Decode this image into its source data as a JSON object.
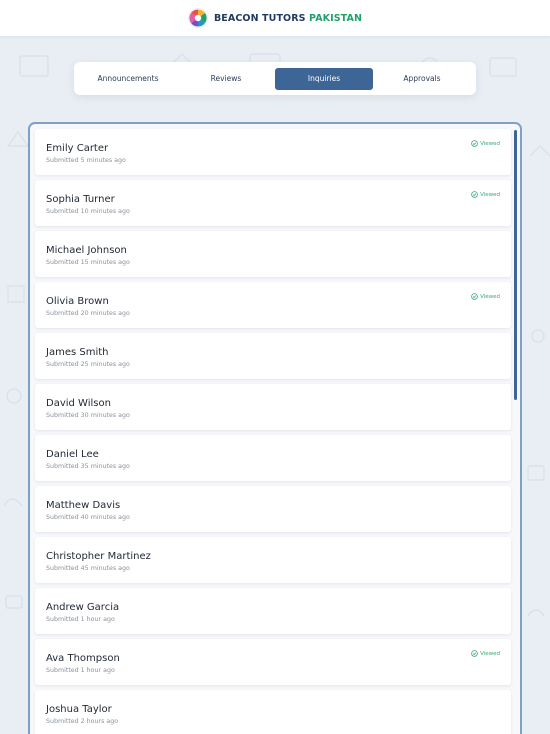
{
  "brand": {
    "name_main": "BEACON TUTORS",
    "name_accent": "PAKISTAN"
  },
  "tabs": [
    {
      "label": "Announcements",
      "active": false
    },
    {
      "label": "Reviews",
      "active": false
    },
    {
      "label": "Inquiries",
      "active": true
    },
    {
      "label": "Approvals",
      "active": false
    }
  ],
  "inquiries": [
    {
      "name": "Emily Carter",
      "submitted": "Submitted 5 minutes ago",
      "viewed": true
    },
    {
      "name": "Sophia Turner",
      "submitted": "Submitted 10 minutes ago",
      "viewed": true
    },
    {
      "name": "Michael Johnson",
      "submitted": "Submitted 15 minutes ago",
      "viewed": false
    },
    {
      "name": "Olivia Brown",
      "submitted": "Submitted 20 minutes ago",
      "viewed": true
    },
    {
      "name": "James Smith",
      "submitted": "Submitted 25 minutes ago",
      "viewed": false
    },
    {
      "name": "David Wilson",
      "submitted": "Submitted 30 minutes ago",
      "viewed": false
    },
    {
      "name": "Daniel Lee",
      "submitted": "Submitted 35 minutes ago",
      "viewed": false
    },
    {
      "name": "Matthew Davis",
      "submitted": "Submitted 40 minutes ago",
      "viewed": false
    },
    {
      "name": "Christopher Martinez",
      "submitted": "Submitted 45 minutes ago",
      "viewed": false
    },
    {
      "name": "Andrew Garcia",
      "submitted": "Submitted 1 hour ago",
      "viewed": false
    },
    {
      "name": "Ava Thompson",
      "submitted": "Submitted 1 hour ago",
      "viewed": true
    },
    {
      "name": "Joshua Taylor",
      "submitted": "Submitted 2 hours ago",
      "viewed": false
    }
  ],
  "viewed_label": "Viewed",
  "colors": {
    "accent": "#3d6696",
    "brand_green": "#22a06b",
    "viewed": "#3aa777"
  }
}
